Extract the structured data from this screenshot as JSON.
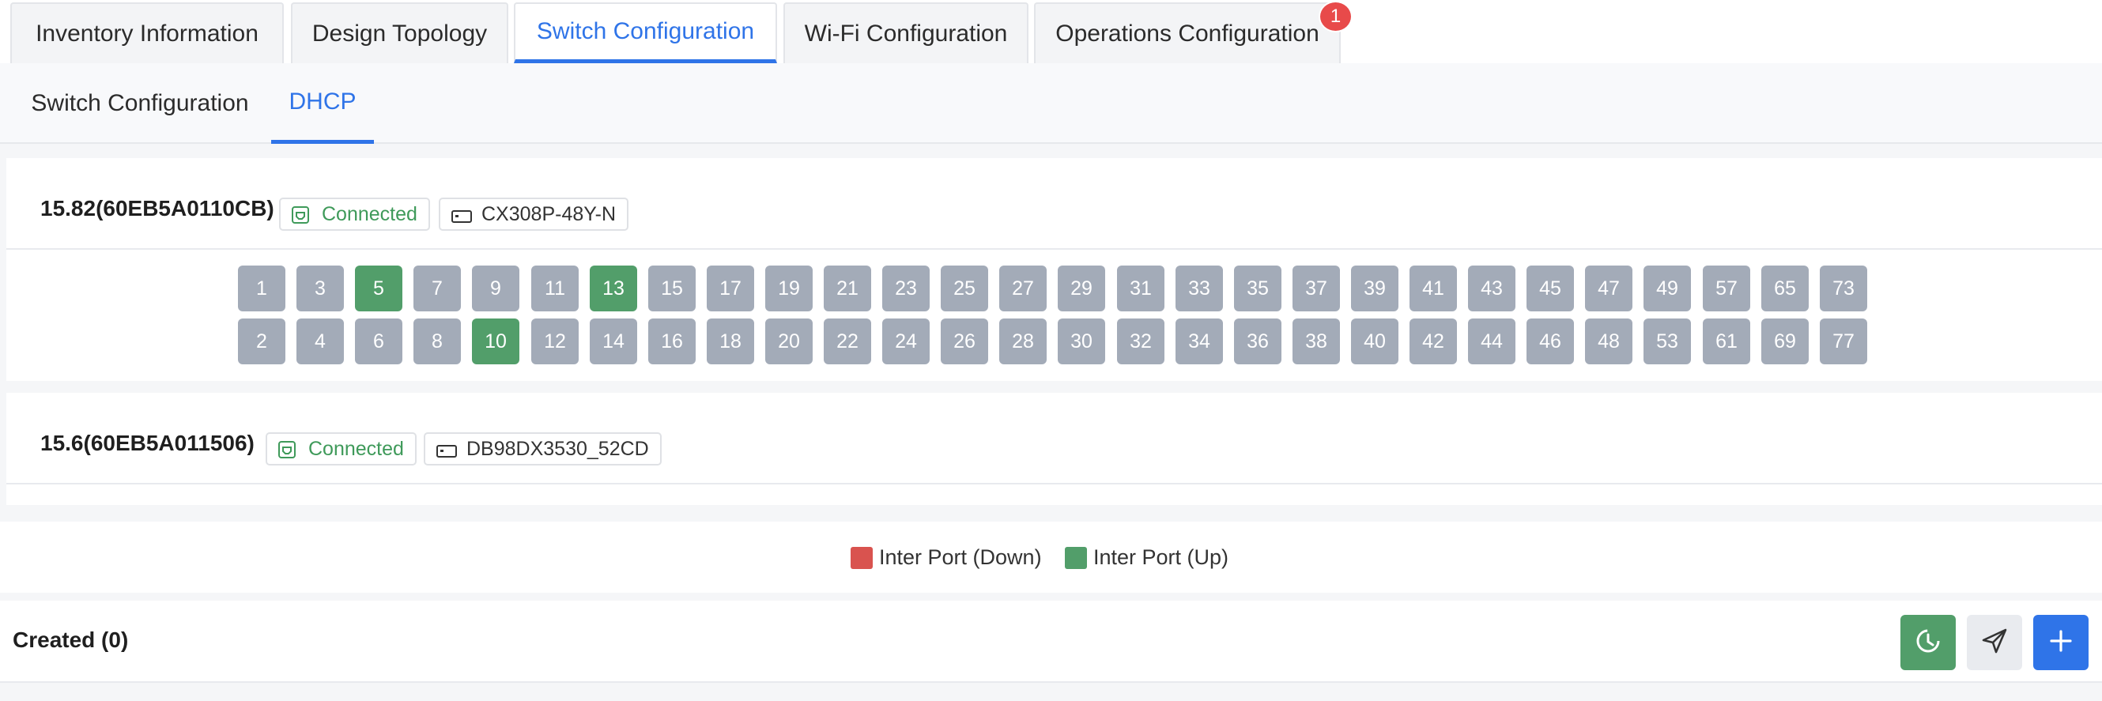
{
  "top_tabs": [
    {
      "label": "Inventory Information"
    },
    {
      "label": "Design Topology"
    },
    {
      "label": "Switch Configuration",
      "active": true
    },
    {
      "label": "Wi-Fi Configuration"
    },
    {
      "label": "Operations Configuration",
      "badge": "1"
    }
  ],
  "sub_tabs": [
    {
      "label": "Switch Configuration"
    },
    {
      "label": "DHCP",
      "active": true
    }
  ],
  "devices": [
    {
      "name": "15.82(60EB5A0110CB)",
      "status": "Connected",
      "model": "CX308P-48Y-N",
      "ports_top": [
        "1",
        "3",
        "5",
        "7",
        "9",
        "11",
        "13",
        "15",
        "17",
        "19",
        "21",
        "23",
        "25",
        "27",
        "29",
        "31",
        "33",
        "35",
        "37",
        "39",
        "41",
        "43",
        "45",
        "47",
        "49",
        "57",
        "65",
        "73"
      ],
      "ports_bottom": [
        "2",
        "4",
        "6",
        "8",
        "10",
        "12",
        "14",
        "16",
        "18",
        "20",
        "22",
        "24",
        "26",
        "28",
        "30",
        "32",
        "34",
        "36",
        "38",
        "40",
        "42",
        "44",
        "46",
        "48",
        "53",
        "61",
        "69",
        "77"
      ],
      "ports_up": [
        "5",
        "13",
        "10"
      ]
    },
    {
      "name": "15.6(60EB5A011506)",
      "status": "Connected",
      "model": "DB98DX3530_52CD"
    }
  ],
  "legend": {
    "down_label": "Inter Port (Down)",
    "up_label": "Inter Port (Up)",
    "down_color": "#d9534f",
    "up_color": "#529e6a"
  },
  "created": {
    "title": "Created (0)"
  },
  "actions": [
    {
      "icon": "clock-refresh-icon",
      "color": "#529e6a"
    },
    {
      "icon": "send-icon",
      "color": "#e9ebef"
    },
    {
      "icon": "plus-icon",
      "color": "#2f74e8"
    }
  ],
  "colors": {
    "accent": "#2f74e8",
    "connected": "#3f9a5a",
    "port_idle": "#a3abb8",
    "port_up": "#529e6a",
    "badge": "#e84a4a"
  }
}
